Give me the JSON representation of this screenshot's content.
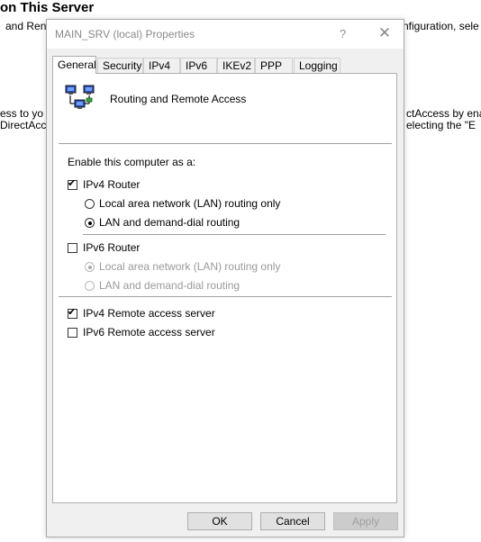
{
  "background": {
    "title": "on This Server",
    "line1_left": "and Ren",
    "line1_right": "nfiguration, sele",
    "line2_left": "ess to yo",
    "line2_right": "ctAccess by ena",
    "line3_left": "DirectAcc",
    "line3_right": "electing the \"E"
  },
  "dialog": {
    "title": "MAIN_SRV (local) Properties",
    "help_glyph": "?",
    "close_glyph": "✕",
    "tabs": [
      {
        "label": "General",
        "active": true
      },
      {
        "label": "Security"
      },
      {
        "label": "IPv4"
      },
      {
        "label": "IPv6"
      },
      {
        "label": "IKEv2"
      },
      {
        "label": "PPP"
      },
      {
        "label": "Logging"
      }
    ],
    "general": {
      "icon": "network-computers-icon",
      "heading": "Routing and Remote Access",
      "enable_label": "Enable this computer as a:",
      "ipv4_router": {
        "label": "IPv4 Router",
        "checked": true
      },
      "ipv4_options": [
        {
          "label": "Local area network (LAN) routing only",
          "selected": false
        },
        {
          "label": "LAN and demand-dial routing",
          "selected": true
        }
      ],
      "ipv6_router": {
        "label": "IPv6 Router",
        "checked": false
      },
      "ipv6_options": [
        {
          "label": "Local area network (LAN) routing only",
          "selected": true,
          "disabled": true
        },
        {
          "label": "LAN and demand-dial routing",
          "selected": false,
          "disabled": true
        }
      ],
      "ipv4_remote_access": {
        "label": "IPv4 Remote access server",
        "checked": true
      },
      "ipv6_remote_access": {
        "label": "IPv6 Remote access server",
        "checked": false
      }
    },
    "buttons": {
      "ok": "OK",
      "cancel": "Cancel",
      "apply": "Apply"
    }
  }
}
